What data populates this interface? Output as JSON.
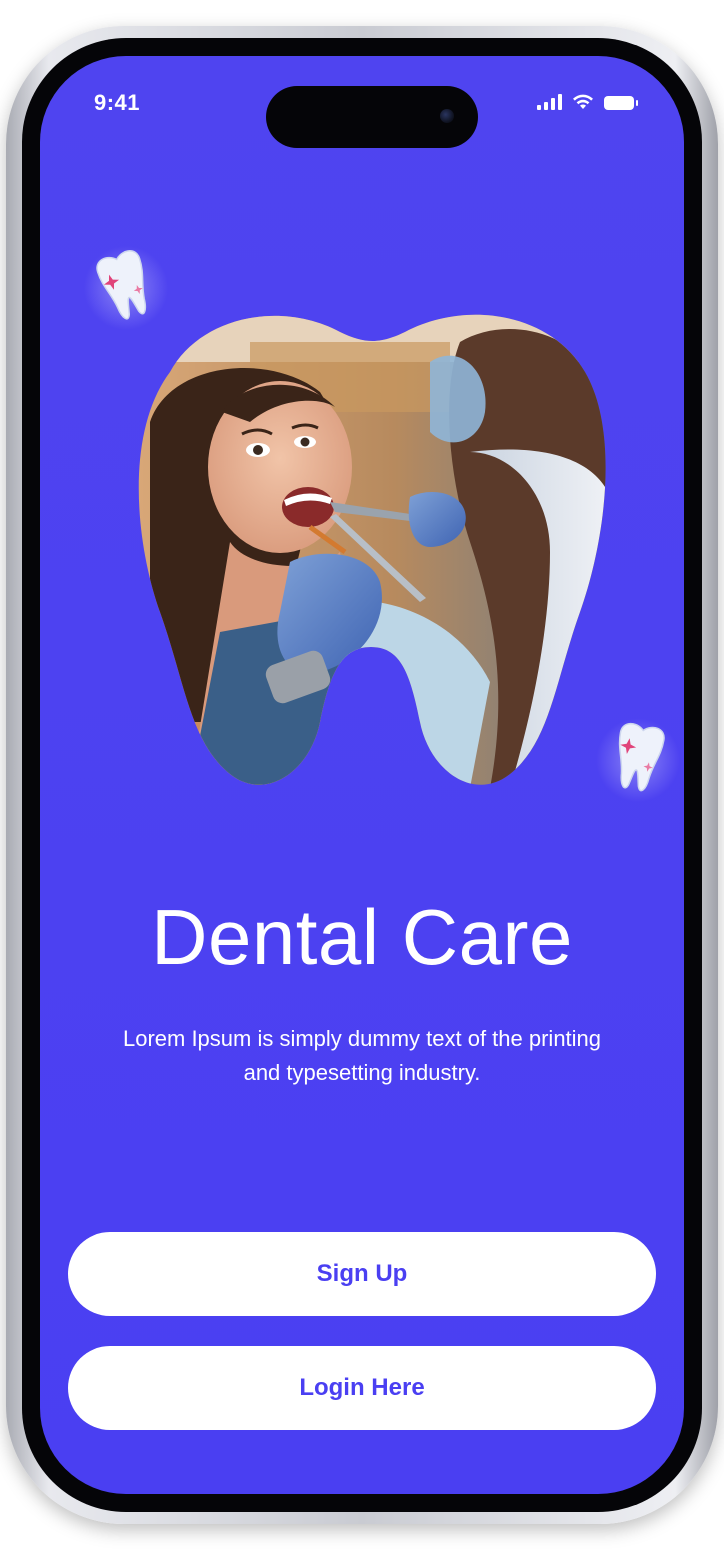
{
  "status_bar": {
    "time": "9:41",
    "icons": [
      "cellular-signal-icon",
      "wifi-icon",
      "battery-icon"
    ]
  },
  "hero": {
    "image": "photo of a smiling woman in a dental chair being examined by a dentist, masked in a tooth shape",
    "decorations": [
      "sparkle-tooth-icon",
      "sparkle-tooth-icon"
    ]
  },
  "content": {
    "title": "Dental Care",
    "subtitle": "Lorem Ipsum is simply dummy text of the printing and typesetting industry."
  },
  "actions": {
    "signup_label": "Sign Up",
    "login_label": "Login Here"
  },
  "colors": {
    "brand": "#4a3ff2",
    "background": "#4f44f0",
    "button_bg": "#ffffff",
    "text_on_brand": "#ffffff"
  }
}
